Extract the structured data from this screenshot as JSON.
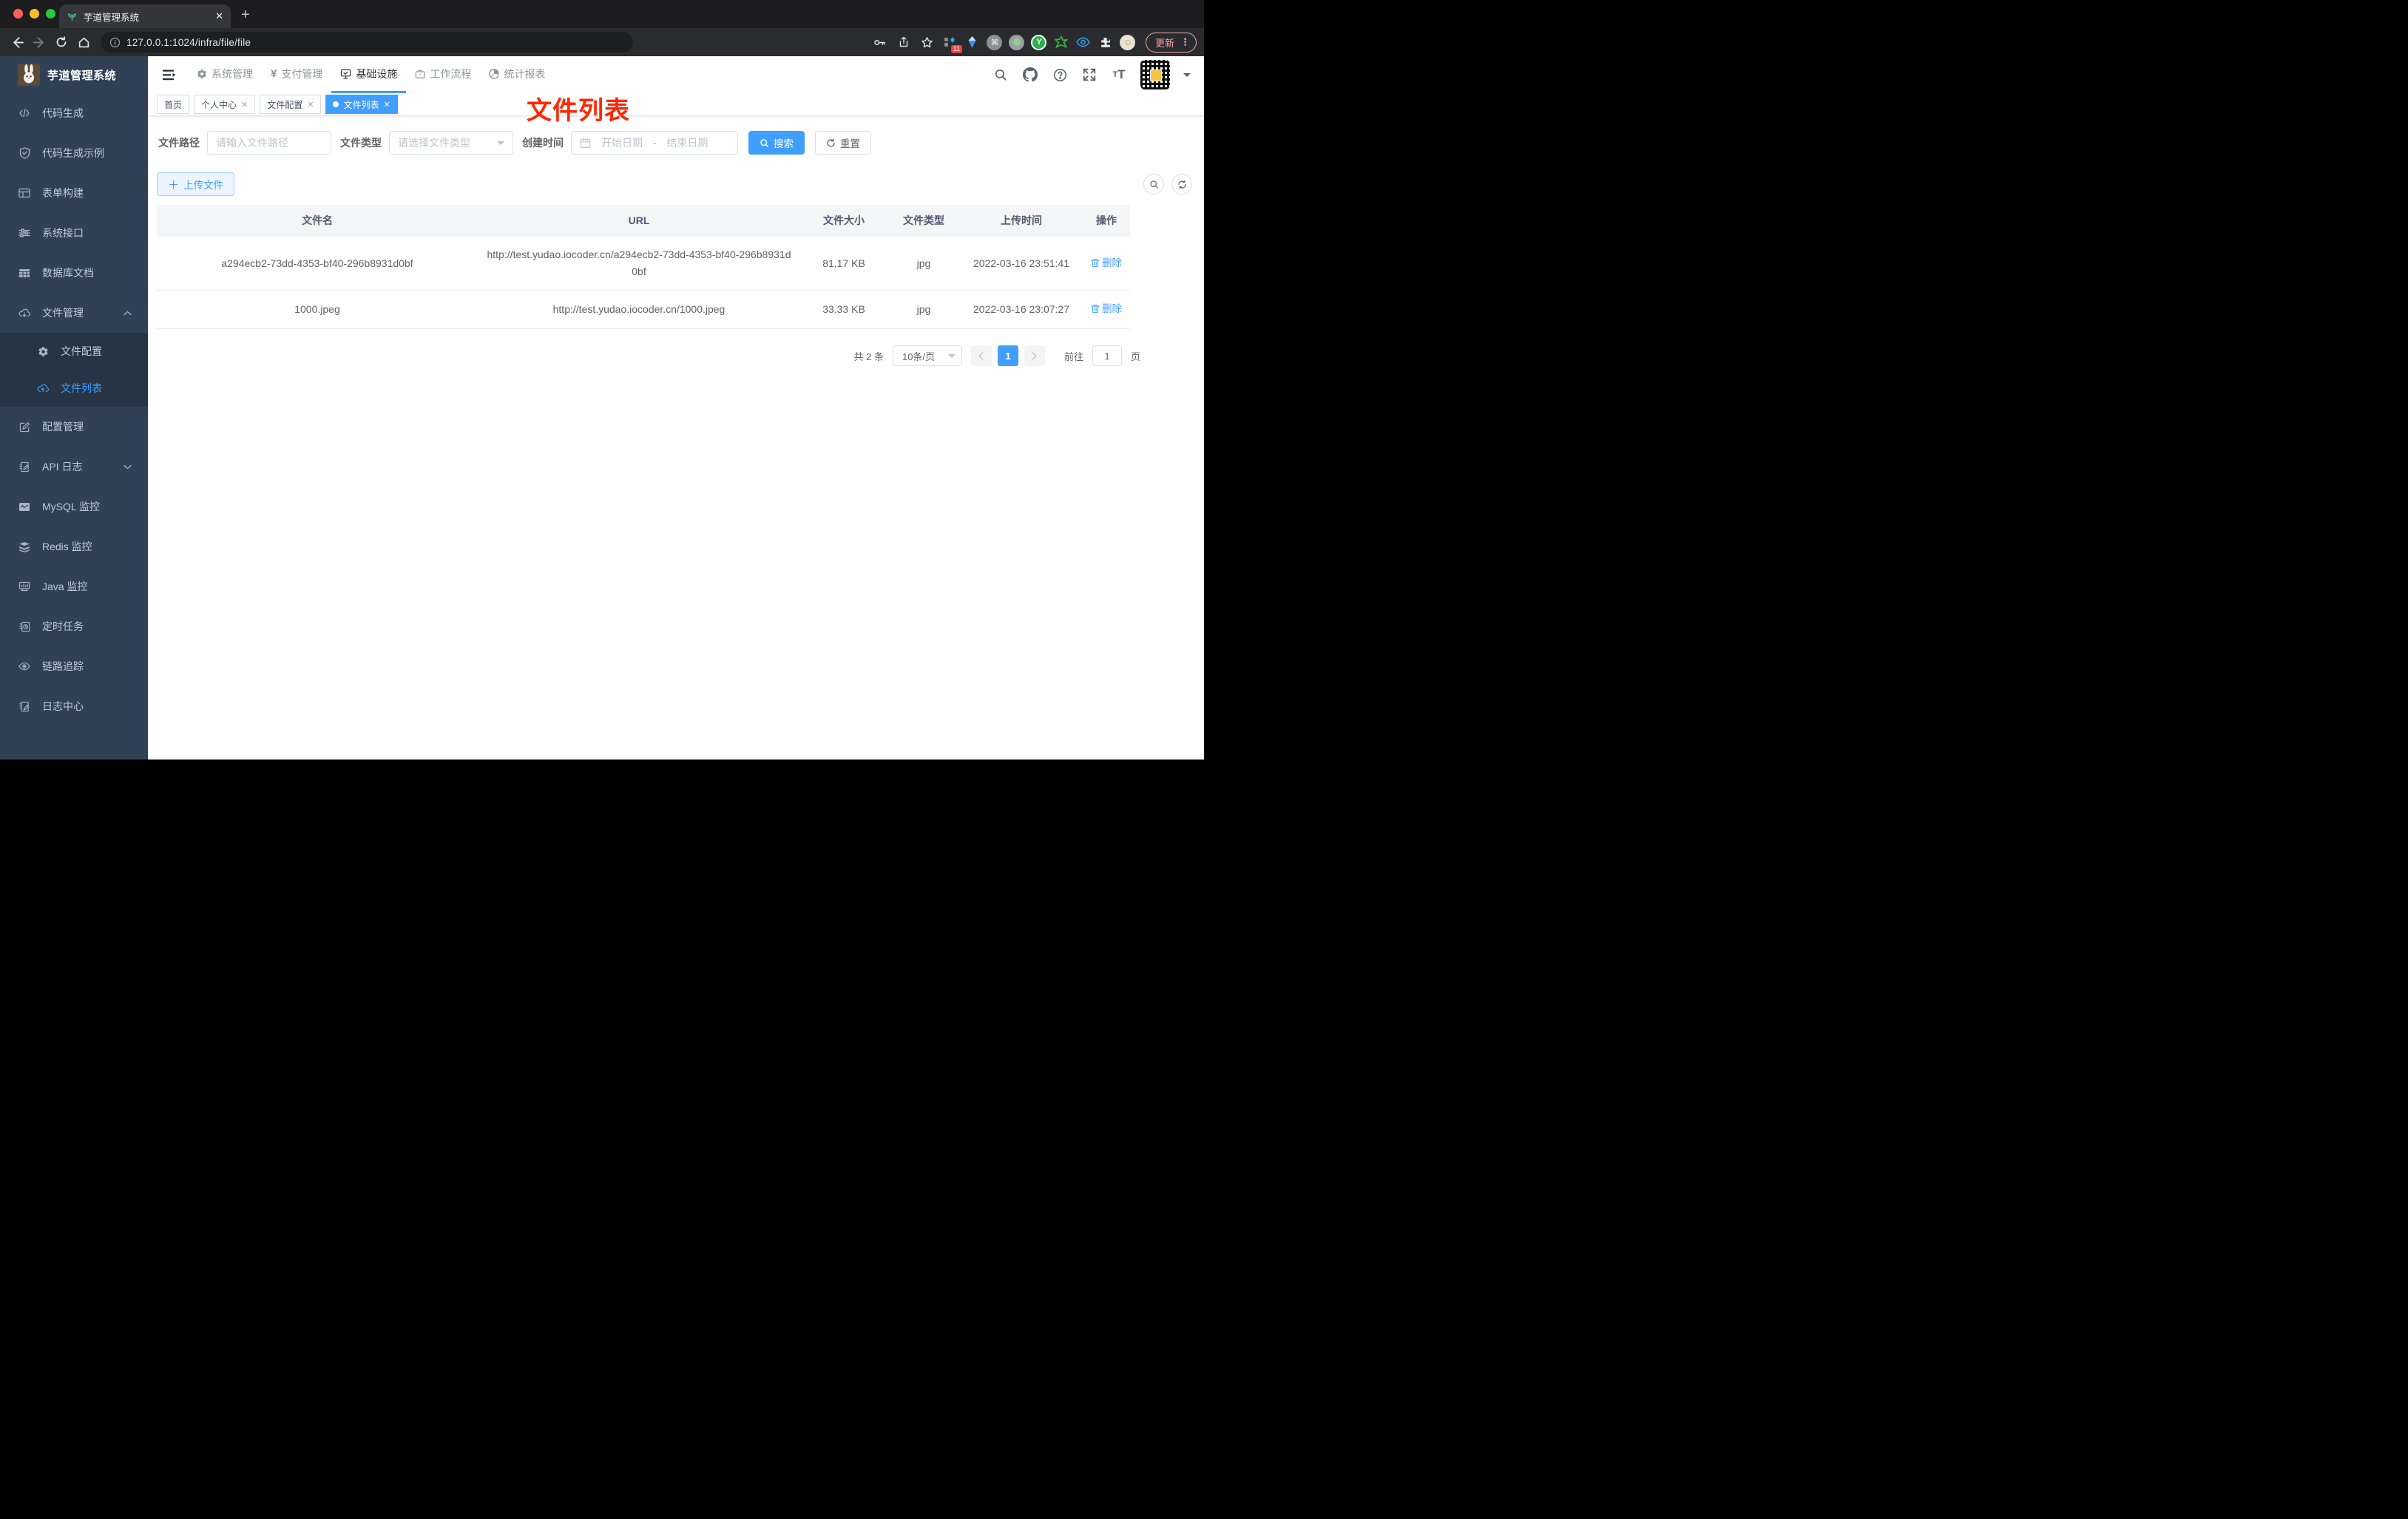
{
  "colors": {
    "accent": "#409eff",
    "annotation_red": "#ff2600",
    "sidebar_bg": "#304156",
    "submenu_bg": "#263445"
  },
  "browser": {
    "tab_title": "芋道管理系统",
    "url": "127.0.0.1:1024/infra/file/file",
    "extension_badge": "11",
    "update_label": "更新"
  },
  "sidebar": {
    "title": "芋道管理系统",
    "items": [
      {
        "label": "代码生成"
      },
      {
        "label": "代码生成示例"
      },
      {
        "label": "表单构建"
      },
      {
        "label": "系统接口"
      },
      {
        "label": "数据库文档"
      },
      {
        "label": "文件管理"
      },
      {
        "label": "配置管理"
      },
      {
        "label": "API 日志"
      },
      {
        "label": "MySQL 监控"
      },
      {
        "label": "Redis 监控"
      },
      {
        "label": "Java 监控"
      },
      {
        "label": "定时任务"
      },
      {
        "label": "链路追踪"
      },
      {
        "label": "日志中心"
      }
    ],
    "submenu": [
      {
        "label": "文件配置"
      },
      {
        "label": "文件列表",
        "active": true
      }
    ]
  },
  "header": {
    "menus": [
      {
        "label": "系统管理"
      },
      {
        "label": "支付管理"
      },
      {
        "label": "基础设施",
        "active": true
      },
      {
        "label": "工作流程"
      },
      {
        "label": "统计报表"
      }
    ]
  },
  "tags": [
    {
      "label": "首页"
    },
    {
      "label": "个人中心"
    },
    {
      "label": "文件配置"
    },
    {
      "label": "文件列表",
      "active": true
    }
  ],
  "annotation": {
    "text": "文件列表"
  },
  "filters": {
    "path_label": "文件路径",
    "path_placeholder": "请输入文件路径",
    "type_label": "文件类型",
    "type_placeholder": "请选择文件类型",
    "date_label": "创建时间",
    "date_start_placeholder": "开始日期",
    "date_separator": "-",
    "date_end_placeholder": "结束日期",
    "search_label": "搜索",
    "reset_label": "重置"
  },
  "toolbar": {
    "upload_label": "上传文件"
  },
  "table": {
    "headers": [
      "文件名",
      "URL",
      "文件大小",
      "文件类型",
      "上传时间",
      "操作"
    ],
    "rows": [
      {
        "name": "a294ecb2-73dd-4353-bf40-296b8931d0bf",
        "url": "http://test.yudao.iocoder.cn/a294ecb2-73dd-4353-bf40-296b8931d0bf",
        "size": "81.17 KB",
        "type": "jpg",
        "time": "2022-03-16 23:51:41",
        "action": "删除"
      },
      {
        "name": "1000.jpeg",
        "url": "http://test.yudao.iocoder.cn/1000.jpeg",
        "size": "33.33 KB",
        "type": "jpg",
        "time": "2022-03-16 23:07:27",
        "action": "删除"
      }
    ]
  },
  "pagination": {
    "total": "共 2 条",
    "page_size": "10条/页",
    "page": "1",
    "goto_label": "前往",
    "goto_value": "1",
    "unit_label": "页"
  }
}
